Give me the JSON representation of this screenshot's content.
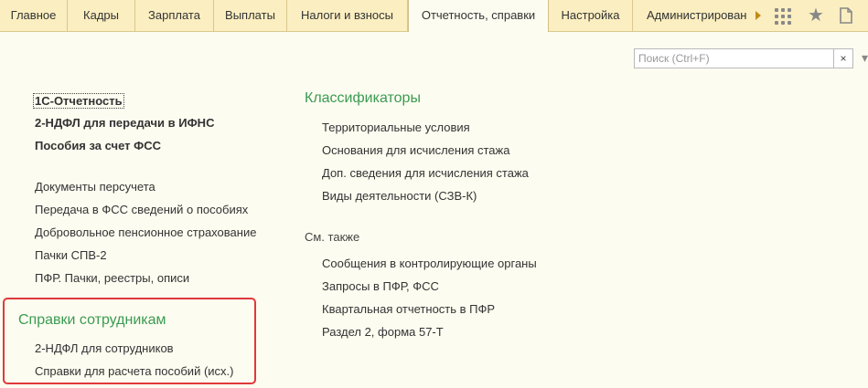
{
  "tabs": [
    {
      "label": "Главное"
    },
    {
      "label": "Кадры"
    },
    {
      "label": "Зарплата"
    },
    {
      "label": "Выплаты"
    },
    {
      "label": "Налоги и взносы"
    },
    {
      "label": "Отчетность, справки"
    },
    {
      "label": "Настройка"
    },
    {
      "label": "Администрирован"
    }
  ],
  "active_tab": "Отчетность, справки",
  "search": {
    "placeholder": "Поиск (Ctrl+F)",
    "value": "",
    "clear": "×"
  },
  "left": {
    "bold_links": [
      "1С-Отчетность",
      "2-НДФЛ для передачи в ИФНС",
      "Пособия за счет ФСС"
    ],
    "links": [
      "Документы персучета",
      "Передача в ФСС сведений о пособиях",
      "Добровольное пенсионное страхование",
      "Пачки СПВ-2",
      "ПФР. Пачки, реестры, описи"
    ],
    "section": {
      "title": "Справки сотрудникам",
      "links": [
        "2-НДФЛ для сотрудников",
        "Справки для расчета пособий (исх.)"
      ]
    }
  },
  "right": {
    "title": "Классификаторы",
    "links": [
      "Территориальные условия",
      "Основания для исчисления стажа",
      "Доп. сведения для исчисления стажа",
      "Виды деятельности (СЗВ-К)"
    ],
    "see_also": {
      "title": "См. также",
      "links": [
        "Сообщения в контролирующие органы",
        "Запросы в ПФР, ФСС",
        "Квартальная отчетность в ПФР",
        "Раздел 2, форма 57-Т"
      ]
    }
  },
  "colors": {
    "accent_green": "#3a9b52",
    "highlight_red": "#e0393a",
    "tab_bar": "#fbeec0"
  }
}
